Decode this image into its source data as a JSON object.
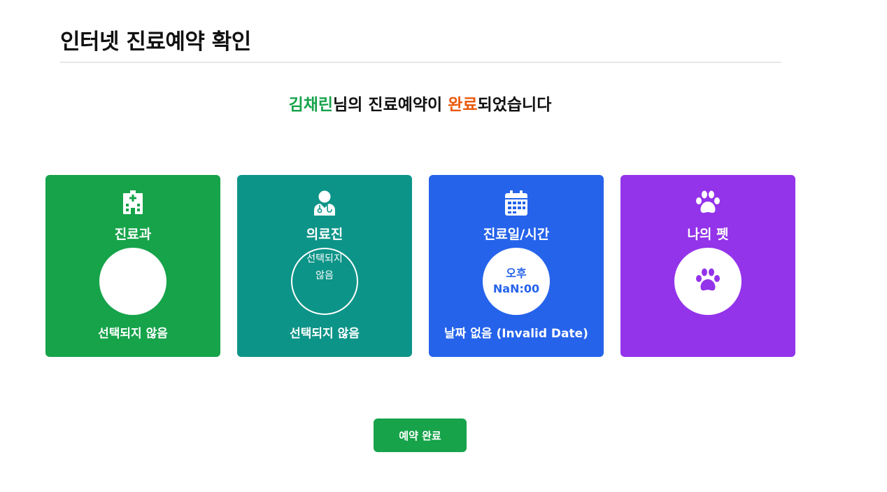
{
  "header": {
    "title": "인터넷 진료예약 확인"
  },
  "message": {
    "patient_name": "김채린",
    "text_middle": "님의 진료예약이 ",
    "status_word": "완료",
    "text_end": "되었습니다"
  },
  "cards": [
    {
      "title": "진료과",
      "icon": "hospital-icon",
      "color": "#16a34a",
      "circle_text": "",
      "footer": "선택되지 않음"
    },
    {
      "title": "의료진",
      "icon": "doctor-icon",
      "color": "#0d9488",
      "circle_line1": "선택되지",
      "circle_line2": "않음",
      "footer": "선택되지 않음"
    },
    {
      "title": "진료일/시간",
      "icon": "calendar-icon",
      "color": "#2563eb",
      "circle_line1": "오후",
      "circle_line2": "NaN:00",
      "footer": "날짜 없음 (Invalid Date)"
    },
    {
      "title": "나의 펫",
      "icon": "paw-icon",
      "color": "#9333ea",
      "circle_icon": "paw-icon",
      "footer": ""
    }
  ],
  "actions": {
    "confirm_label": "예약 완료"
  },
  "colors": {
    "name_accent": "#16a34a",
    "status_accent": "#ea580c",
    "button": "#16a34a"
  }
}
